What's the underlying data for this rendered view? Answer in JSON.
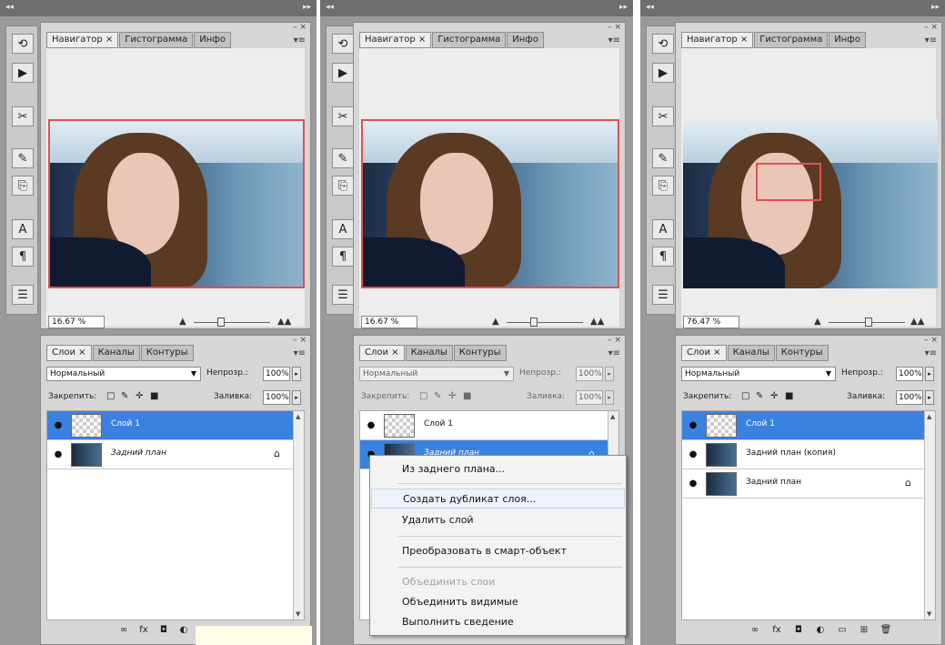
{
  "screens": [
    {
      "nav_tabs": [
        "Навигатор ×",
        "Гистограмма",
        "Инфо"
      ],
      "zoom": "16.67 %",
      "layer_tabs": [
        "Слои ×",
        "Каналы",
        "Контуры"
      ],
      "blend_mode": "Нормальный",
      "opacity_label": "Непрозр.:",
      "opacity": "100%",
      "lock_label": "Закрепить:",
      "fill_label": "Заливка:",
      "fill": "100%",
      "layers": [
        {
          "name": "Слой 1",
          "selected": true,
          "thumb": "transparent"
        },
        {
          "name": "Задний план",
          "selected": false,
          "thumb": "photo",
          "locked": true
        }
      ]
    },
    {
      "nav_tabs": [
        "Навигатор ×",
        "Гистограмма",
        "Инфо"
      ],
      "zoom": "16.67 %",
      "layer_tabs": [
        "Слои ×",
        "Каналы",
        "Контуры"
      ],
      "blend_mode": "Нормальный",
      "opacity_label": "Непрозр.:",
      "opacity": "100%",
      "lock_label": "Закрепить:",
      "fill_label": "Заливка:",
      "fill": "100%",
      "layers": [
        {
          "name": "Слой 1",
          "selected": false,
          "thumb": "transparent"
        },
        {
          "name": "Задний план",
          "selected": true,
          "thumb": "photo",
          "locked": true
        }
      ]
    },
    {
      "nav_tabs": [
        "Навигатор ×",
        "Гистограмма",
        "Инфо"
      ],
      "zoom": "76.47 %",
      "layer_tabs": [
        "Слои ×",
        "Каналы",
        "Контуры"
      ],
      "blend_mode": "Нормальный",
      "opacity_label": "Непрозр.:",
      "opacity": "100%",
      "lock_label": "Закрепить:",
      "fill_label": "Заливка:",
      "fill": "100%",
      "layers": [
        {
          "name": "Слой 1",
          "selected": true,
          "thumb": "transparent"
        },
        {
          "name": "Задний план (копия)",
          "selected": false,
          "thumb": "photo"
        },
        {
          "name": "Задний план",
          "selected": false,
          "thumb": "photo",
          "locked": true
        }
      ]
    }
  ],
  "context_menu": [
    {
      "label": "Из заднего плана...",
      "disabled": false
    },
    {
      "label": "Создать дубликат слоя...",
      "disabled": false,
      "highlighted": true
    },
    {
      "label": "Удалить слой",
      "disabled": false
    },
    {
      "label": "Преобразовать в смарт-объект",
      "disabled": false
    },
    {
      "label": "Объединить слои",
      "disabled": true
    },
    {
      "label": "Объединить видимые",
      "disabled": false
    },
    {
      "label": "Выполнить сведение",
      "disabled": false
    }
  ],
  "icons": {
    "collapse": "◂◂",
    "expand": "▸▸",
    "panel_menu": "▾≡",
    "eye": "●",
    "lock": "🔒",
    "fx": "fx"
  },
  "colors": {
    "selection": "#3b82e0",
    "view_box": "#e05050"
  }
}
